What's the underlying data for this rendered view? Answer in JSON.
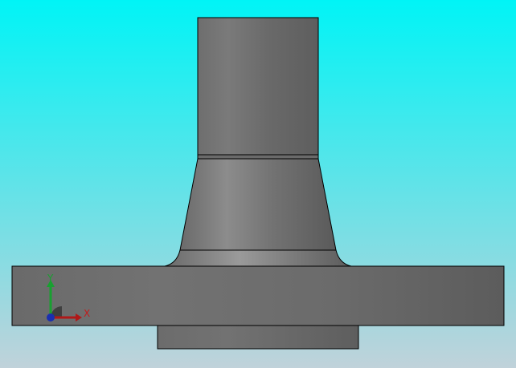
{
  "viewport": {
    "background_top": "#00f4f6",
    "background_bottom": "#c0d2da"
  },
  "model": {
    "name": "flange",
    "surface_dark": "#5c5c5c",
    "surface_mid": "#727272",
    "surface_light": "#8c8c8c",
    "edge_color": "#000000"
  },
  "triad": {
    "x_label": "X",
    "y_label": "Y",
    "x_color": "#c21c1c",
    "y_color": "#18a030",
    "z_color": "#1a2fb0"
  }
}
